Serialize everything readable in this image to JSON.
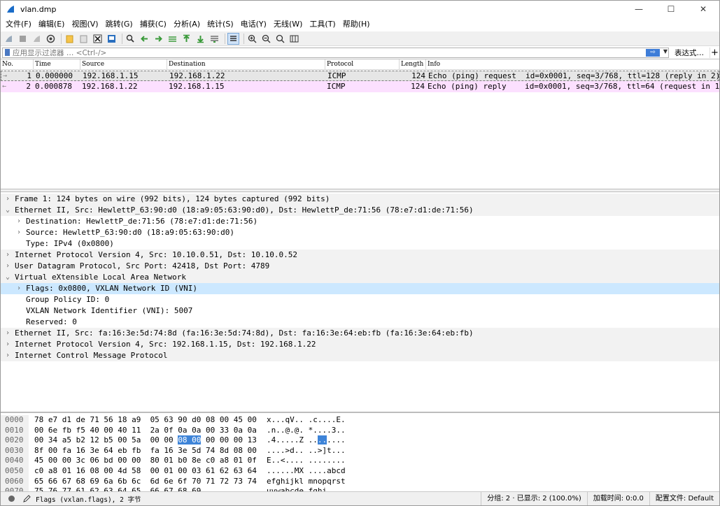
{
  "window": {
    "title": "vlan.dmp",
    "controls": [
      "—",
      "☐",
      "✕"
    ]
  },
  "menu": [
    "文件(F)",
    "编辑(E)",
    "视图(V)",
    "跳转(G)",
    "捕获(C)",
    "分析(A)",
    "统计(S)",
    "电话(Y)",
    "无线(W)",
    "工具(T)",
    "帮助(H)"
  ],
  "filter": {
    "placeholder": "应用显示过滤器 … <Ctrl-/>",
    "apply_label": "⇨",
    "expression_label": "表达式…",
    "plus_label": "+"
  },
  "packet_list": {
    "columns": [
      "No.",
      "Time",
      "Source",
      "Destination",
      "Protocol",
      "Length",
      "Info"
    ],
    "rows": [
      {
        "marker": "→",
        "no": "1",
        "time": "0.000000",
        "source": "192.168.1.15",
        "destination": "192.168.1.22",
        "protocol": "ICMP",
        "length": "124",
        "info": "Echo (ping) request  id=0x0001, seq=3/768, ttl=128 (reply in 2)"
      },
      {
        "marker": "←",
        "no": "2",
        "time": "0.000878",
        "source": "192.168.1.22",
        "destination": "192.168.1.15",
        "protocol": "ICMP",
        "length": "124",
        "info": "Echo (ping) reply    id=0x0001, seq=3/768, ttl=64 (request in 1)"
      }
    ]
  },
  "details": [
    {
      "level": 0,
      "exp": "›",
      "text": "Frame 1: 124 bytes on wire (992 bits), 124 bytes captured (992 bits)",
      "state": "top"
    },
    {
      "level": 0,
      "exp": "⌄",
      "text": "Ethernet II, Src: HewlettP_63:90:d0 (18:a9:05:63:90:d0), Dst: HewlettP_de:71:56 (78:e7:d1:de:71:56)",
      "state": "top"
    },
    {
      "level": 1,
      "exp": "›",
      "text": "Destination: HewlettP_de:71:56 (78:e7:d1:de:71:56)",
      "state": ""
    },
    {
      "level": 1,
      "exp": "›",
      "text": "Source: HewlettP_63:90:d0 (18:a9:05:63:90:d0)",
      "state": ""
    },
    {
      "level": 1,
      "exp": "",
      "text": "Type: IPv4 (0x0800)",
      "state": ""
    },
    {
      "level": 0,
      "exp": "›",
      "text": "Internet Protocol Version 4, Src: 10.10.0.51, Dst: 10.10.0.52",
      "state": "top"
    },
    {
      "level": 0,
      "exp": "›",
      "text": "User Datagram Protocol, Src Port: 42418, Dst Port: 4789",
      "state": "top"
    },
    {
      "level": 0,
      "exp": "⌄",
      "text": "Virtual eXtensible Local Area Network",
      "state": "top"
    },
    {
      "level": 1,
      "exp": "›",
      "text": "Flags: 0x0800, VXLAN Network ID (VNI)",
      "state": "sel"
    },
    {
      "level": 1,
      "exp": "",
      "text": "Group Policy ID: 0",
      "state": ""
    },
    {
      "level": 1,
      "exp": "",
      "text": "VXLAN Network Identifier (VNI): 5007",
      "state": ""
    },
    {
      "level": 1,
      "exp": "",
      "text": "Reserved: 0",
      "state": ""
    },
    {
      "level": 0,
      "exp": "›",
      "text": "Ethernet II, Src: fa:16:3e:5d:74:8d (fa:16:3e:5d:74:8d), Dst: fa:16:3e:64:eb:fb (fa:16:3e:64:eb:fb)",
      "state": "top"
    },
    {
      "level": 0,
      "exp": "›",
      "text": "Internet Protocol Version 4, Src: 192.168.1.15, Dst: 192.168.1.22",
      "state": "top"
    },
    {
      "level": 0,
      "exp": "›",
      "text": "Internet Control Message Protocol",
      "state": "top"
    }
  ],
  "bytes": [
    {
      "off": "0000",
      "pre": "78 e7 d1 de 71 56 18 a9  05 63 90 d0 08 00 45 00",
      "hl": "",
      "post": "",
      "apre": "x...qV.. .c....E.",
      "ahl": "",
      "apost": ""
    },
    {
      "off": "0010",
      "pre": "00 6e fb f5 40 00 40 11  2a 0f 0a 0a 00 33 0a 0a",
      "hl": "",
      "post": "",
      "apre": ".n..@.@. *....3..",
      "ahl": "",
      "apost": ""
    },
    {
      "off": "0020",
      "pre": "00 34 a5 b2 12 b5 00 5a  00 00 ",
      "hl": "08 00",
      "post": " 00 00 00 13",
      "apre": ".4.....Z ..",
      "ahl": "..",
      "apost": "...."
    },
    {
      "off": "0030",
      "pre": "8f 00 fa 16 3e 64 eb fb  fa 16 3e 5d 74 8d 08 00",
      "hl": "",
      "post": "",
      "apre": "....>d.. ..>]t...",
      "ahl": "",
      "apost": ""
    },
    {
      "off": "0040",
      "pre": "45 00 00 3c 06 bd 00 00  80 01 b0 8e c0 a8 01 0f",
      "hl": "",
      "post": "",
      "apre": "E..<.... ........",
      "ahl": "",
      "apost": ""
    },
    {
      "off": "0050",
      "pre": "c0 a8 01 16 08 00 4d 58  00 01 00 03 61 62 63 64",
      "hl": "",
      "post": "",
      "apre": "......MX ....abcd",
      "ahl": "",
      "apost": ""
    },
    {
      "off": "0060",
      "pre": "65 66 67 68 69 6a 6b 6c  6d 6e 6f 70 71 72 73 74",
      "hl": "",
      "post": "",
      "apre": "efghijkl mnopqrst",
      "ahl": "",
      "apost": ""
    },
    {
      "off": "0070",
      "pre": "75 76 77 61 62 63 64 65  66 67 68 69",
      "hl": "",
      "post": "",
      "apre": "uvwabcde fghi",
      "ahl": "",
      "apost": ""
    }
  ],
  "status": {
    "field_text": "Flags (vxlan.flags), 2 字节",
    "packets": "分组: 2 · 已显示: 2 (100.0%)",
    "load_time": "加载时间: 0:0.0",
    "profile": "配置文件: Default"
  }
}
